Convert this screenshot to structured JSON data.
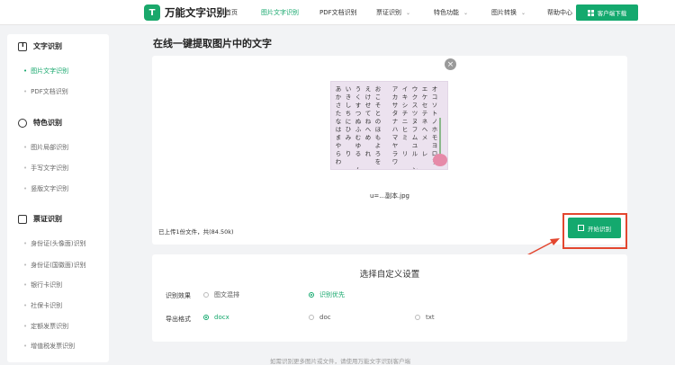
{
  "header": {
    "app_name": "万能文字识别",
    "nav": [
      {
        "label": "首页",
        "has_dropdown": false,
        "active": false
      },
      {
        "label": "图片文字识别",
        "has_dropdown": false,
        "active": true
      },
      {
        "label": "PDF文档识别",
        "has_dropdown": false,
        "active": false
      },
      {
        "label": "票证识别",
        "has_dropdown": true,
        "active": false
      },
      {
        "label": "特色功能",
        "has_dropdown": true,
        "active": false
      },
      {
        "label": "图片转换",
        "has_dropdown": true,
        "active": false
      },
      {
        "label": "帮助中心",
        "has_dropdown": false,
        "active": false
      }
    ],
    "download_label": "客户端下载"
  },
  "sidebar": {
    "sections": [
      {
        "title": "文字识别",
        "icon": "text-icon",
        "items": [
          {
            "label": "图片文字识别",
            "active": true
          },
          {
            "label": "PDF文档识别",
            "active": false
          }
        ]
      },
      {
        "title": "特色识别",
        "icon": "feature-icon",
        "items": [
          {
            "label": "图片局部识别",
            "active": false
          },
          {
            "label": "手写文字识别",
            "active": false
          },
          {
            "label": "竖版文字识别",
            "active": false
          }
        ]
      },
      {
        "title": "票证识别",
        "icon": "card-icon",
        "items": [
          {
            "label": "身份证(头像面)识别",
            "active": false
          },
          {
            "label": "身份证(国徽面)识别",
            "active": false
          },
          {
            "label": "银行卡识别",
            "active": false
          },
          {
            "label": "社保卡识别",
            "active": false
          },
          {
            "label": "定额发票识别",
            "active": false
          },
          {
            "label": "增值税发票识别",
            "active": false
          }
        ]
      }
    ]
  },
  "main": {
    "title": "在线一键提取图片中的文字",
    "file": {
      "name": "u=...副本.jpg",
      "kana_left": [
        "あ",
        "い",
        "う",
        "え",
        "お",
        "か",
        "き",
        "く",
        "け",
        "こ",
        "さ",
        "し",
        "す",
        "せ",
        "そ",
        "た",
        "ち",
        "つ",
        "て",
        "と",
        "な",
        "に",
        "ぬ",
        "ね",
        "の",
        "は",
        "ひ",
        "ふ",
        "へ",
        "ほ",
        "ま",
        "み",
        "む",
        "め",
        "も",
        "や",
        "",
        "ゆ",
        "",
        "よ",
        "ら",
        "り",
        "る",
        "れ",
        "ろ",
        "わ",
        "",
        "",
        "",
        "を",
        "",
        "",
        "ん",
        "",
        ""
      ],
      "kana_right": [
        "ア",
        "イ",
        "ウ",
        "エ",
        "オ",
        "カ",
        "キ",
        "ク",
        "ケ",
        "コ",
        "サ",
        "シ",
        "ス",
        "セ",
        "ソ",
        "タ",
        "チ",
        "ツ",
        "テ",
        "ト",
        "ナ",
        "ニ",
        "ヌ",
        "ネ",
        "ノ",
        "ハ",
        "ヒ",
        "フ",
        "ヘ",
        "ホ",
        "マ",
        "ミ",
        "ム",
        "メ",
        "モ",
        "ヤ",
        "",
        "ユ",
        "",
        "ヨ",
        "ラ",
        "リ",
        "ル",
        "レ",
        "ロ",
        "ワ",
        "",
        "",
        "",
        "ヲ",
        "",
        "",
        "ン",
        "",
        ""
      ]
    },
    "upload_info": "已上传1份文件，共(84.50k)",
    "ocr_button": "开始识别"
  },
  "settings": {
    "title": "选择自定义设置",
    "effect_label": "识别效果",
    "effect_options": [
      {
        "label": "图文混排",
        "selected": false
      },
      {
        "label": "识别优先",
        "selected": true
      }
    ],
    "format_label": "导出格式",
    "format_options": [
      {
        "label": "docx",
        "selected": true
      },
      {
        "label": "doc",
        "selected": false
      },
      {
        "label": "txt",
        "selected": false
      }
    ]
  },
  "footer_hint": {
    "text": "如需识别更多图片或文件，请使用万能文字识别客户端",
    "link": "万能文字识别"
  },
  "colors": {
    "accent": "#14a96e",
    "highlight": "#e3462f",
    "page_bg": "#f2f3f5"
  }
}
